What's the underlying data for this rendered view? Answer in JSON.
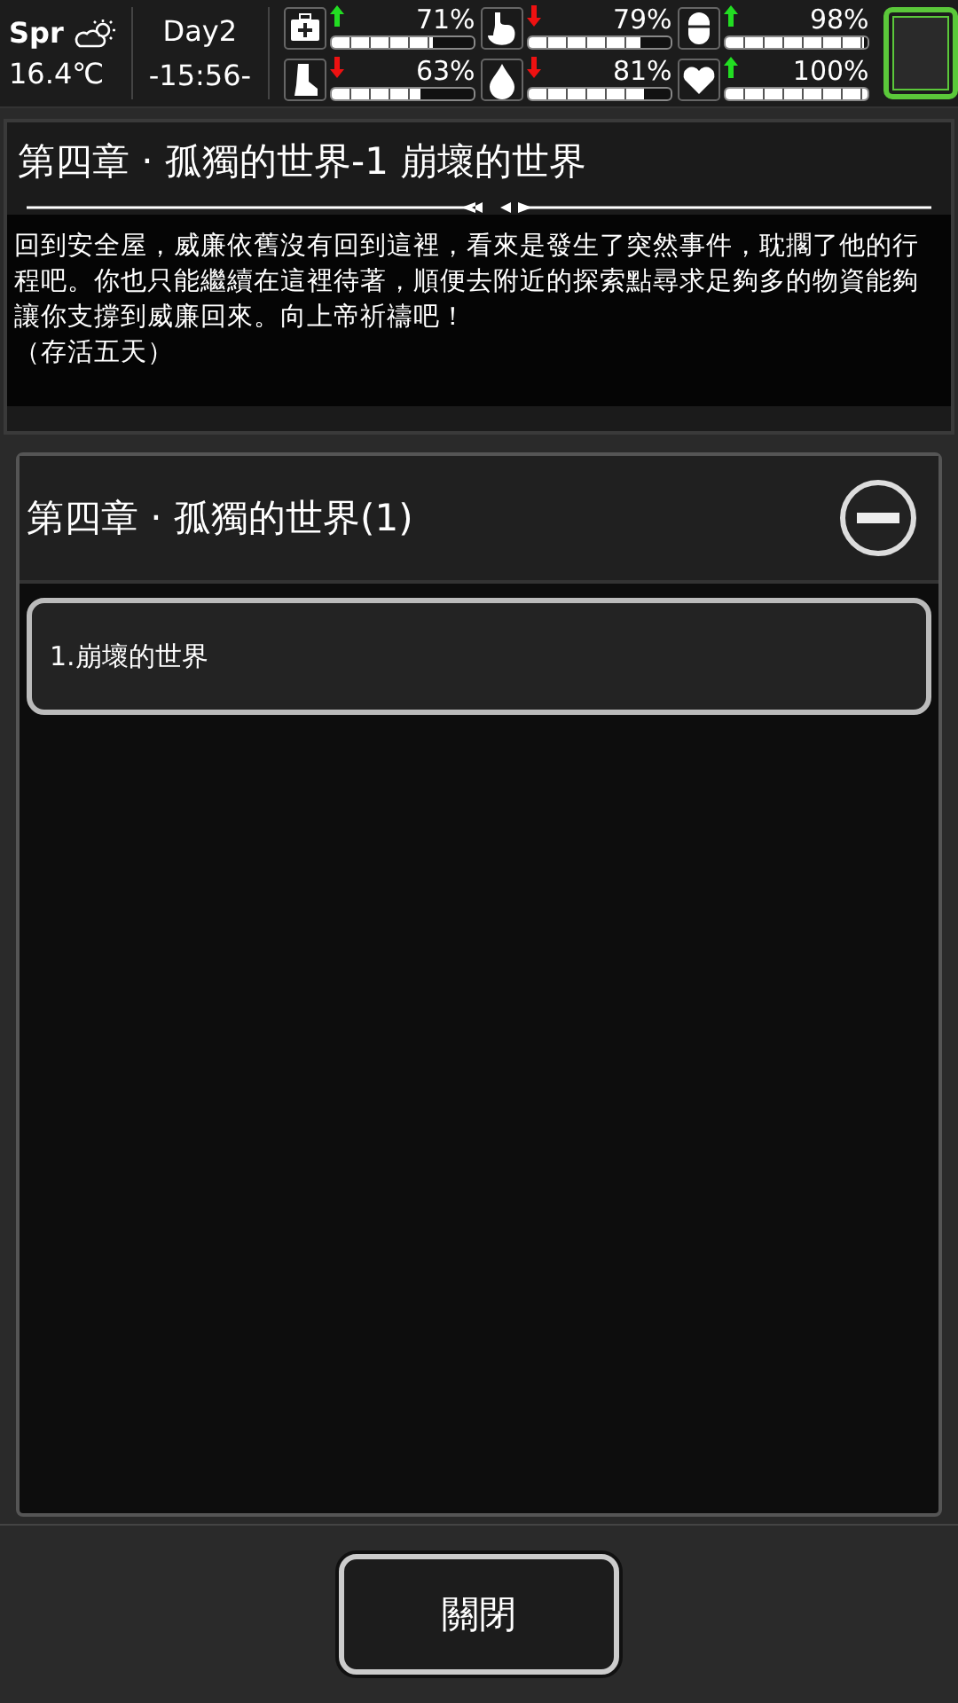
{
  "status_bar": {
    "season": "Spr",
    "temperature": "16.4℃",
    "day": "Day2",
    "time": "-15:56-",
    "stats": [
      {
        "kind": "medkit",
        "rising": true,
        "level": 0.71,
        "reading": "71%"
      },
      {
        "kind": "stomach",
        "rising": false,
        "level": 0.79,
        "reading": "79%"
      },
      {
        "kind": "pill",
        "rising": true,
        "level": 0.98,
        "reading": "98%"
      },
      {
        "kind": "foot",
        "rising": false,
        "level": 0.63,
        "reading": "63%"
      },
      {
        "kind": "drop",
        "rising": false,
        "level": 0.81,
        "reading": "81%"
      },
      {
        "kind": "heart",
        "rising": true,
        "level": 1.0,
        "reading": "100%"
      }
    ]
  },
  "chapter": {
    "title": "第四章 · 孤獨的世界-1 崩壞的世界",
    "description": "回到安全屋，威廉依舊沒有回到這裡，看來是發生了突然事件，耽擱了他的行程吧。你也只能繼續在這裡待著，順便去附近的探索點尋求足夠多的物資能夠讓你支撐到威廉回來。向上帝祈禱吧！",
    "goal": "（存活五天）"
  },
  "section": {
    "title": "第四章 · 孤獨的世界(1)",
    "expanded": true,
    "items": [
      {
        "label": "1.崩壞的世界"
      }
    ]
  },
  "close_button": "關閉"
}
